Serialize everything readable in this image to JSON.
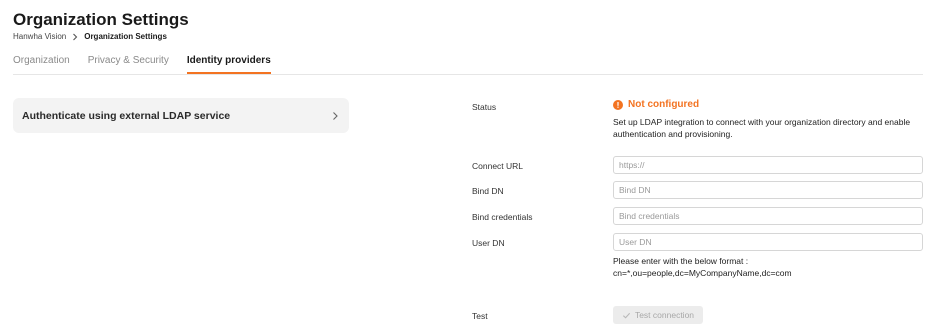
{
  "header": {
    "title": "Organization Settings",
    "breadcrumb": [
      "Hanwha Vision",
      "Organization Settings"
    ]
  },
  "tabs": [
    {
      "label": "Organization",
      "active": false
    },
    {
      "label": "Privacy & Security",
      "active": false
    },
    {
      "label": "Identity providers",
      "active": true
    }
  ],
  "ldap_card": {
    "label": "Authenticate using external LDAP service",
    "icon": "chevron-right-icon"
  },
  "form": {
    "status": {
      "label": "Status",
      "value": "Not configured",
      "icon": "warning-icon",
      "description": "Set up LDAP integration to connect with your organization directory and enable authentication and provisioning."
    },
    "connect_url": {
      "label": "Connect URL",
      "value": "",
      "placeholder": "https://"
    },
    "bind_dn": {
      "label": "Bind DN",
      "value": "",
      "placeholder": "Bind DN"
    },
    "bind_credentials": {
      "label": "Bind credentials",
      "value": "",
      "placeholder": "Bind credentials"
    },
    "user_dn": {
      "label": "User DN",
      "value": "",
      "placeholder": "User DN",
      "hint_line1": "Please enter with the below format :",
      "hint_line2": "cn=*,ou=people,dc=MyCompanyName,dc=com"
    },
    "test": {
      "label": "Test",
      "button_label": "Test connection",
      "button_enabled": false,
      "icon": "check-icon"
    }
  },
  "colors": {
    "accent": "#f37321",
    "card_bg": "#f3f3f3",
    "disabled_bg": "#ececec",
    "disabled_text": "#a8a8a8"
  }
}
